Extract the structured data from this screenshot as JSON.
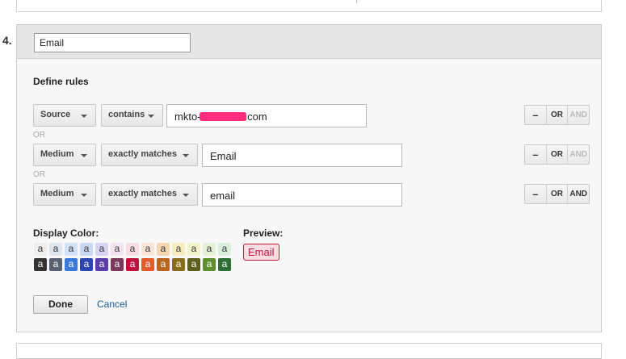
{
  "step_number": "4.",
  "group": {
    "name": "Email"
  },
  "rules_title": "Define rules",
  "rules": [
    {
      "dimension": "Source",
      "operator": "contains",
      "value_prefix": "mkto-",
      "value_suffix": ".com",
      "buttons": {
        "remove": "–",
        "or": "OR",
        "and": "AND"
      }
    },
    {
      "dimension": "Medium",
      "operator": "exactly matches",
      "value": "Email",
      "buttons": {
        "remove": "–",
        "or": "OR",
        "and": "AND"
      }
    },
    {
      "dimension": "Medium",
      "operator": "exactly matches",
      "value": "email",
      "buttons": {
        "remove": "–",
        "or": "OR",
        "and": "AND"
      }
    }
  ],
  "or_separator": "OR",
  "display_color_label": "Display Color:",
  "preview_label": "Preview:",
  "preview_text": "Email",
  "swatch_letter": "a",
  "swatches_light": [
    {
      "bg": "#eeeeee",
      "fg": "#333333"
    },
    {
      "bg": "#dfe5ee",
      "fg": "#333333"
    },
    {
      "bg": "#d4e2f7",
      "fg": "#333333"
    },
    {
      "bg": "#c9d7f5",
      "fg": "#333333"
    },
    {
      "bg": "#d9d2f3",
      "fg": "#333333"
    },
    {
      "bg": "#f3e3ef",
      "fg": "#333333"
    },
    {
      "bg": "#f8dde2",
      "fg": "#333333"
    },
    {
      "bg": "#fbe3d6",
      "fg": "#333333"
    },
    {
      "bg": "#f7d6b2",
      "fg": "#333333"
    },
    {
      "bg": "#f7ecbe",
      "fg": "#333333"
    },
    {
      "bg": "#f1f3c9",
      "fg": "#333333"
    },
    {
      "bg": "#e5f0d4",
      "fg": "#333333"
    },
    {
      "bg": "#dbefdc",
      "fg": "#333333"
    }
  ],
  "swatches_dark": [
    {
      "bg": "#333333",
      "fg": "#ffffff"
    },
    {
      "bg": "#5a6173",
      "fg": "#ffffff"
    },
    {
      "bg": "#3879d9",
      "fg": "#ffffff"
    },
    {
      "bg": "#2b45b3",
      "fg": "#ffffff"
    },
    {
      "bg": "#5b3ea8",
      "fg": "#ffffff"
    },
    {
      "bg": "#7a3a5c",
      "fg": "#ffffff"
    },
    {
      "bg": "#c1123d",
      "fg": "#ffffff"
    },
    {
      "bg": "#e35b2b",
      "fg": "#ffffff"
    },
    {
      "bg": "#b8651f",
      "fg": "#ffffff"
    },
    {
      "bg": "#8a6d1a",
      "fg": "#ffffff"
    },
    {
      "bg": "#5e5e1f",
      "fg": "#ffffff"
    },
    {
      "bg": "#5d8f2f",
      "fg": "#ffffff"
    },
    {
      "bg": "#2f6e35",
      "fg": "#ffffff"
    }
  ],
  "actions": {
    "done": "Done",
    "cancel": "Cancel"
  }
}
